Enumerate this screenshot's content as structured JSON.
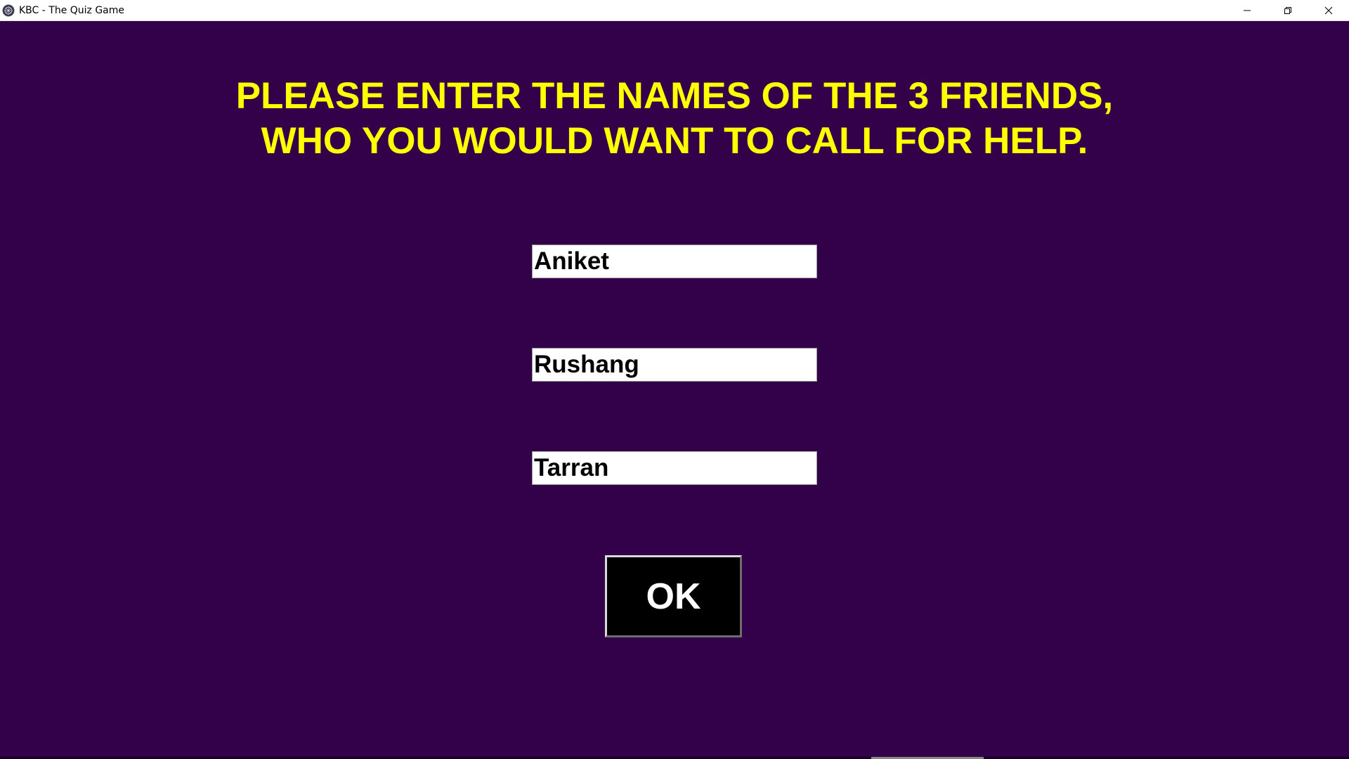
{
  "window": {
    "title": "KBC - The Quiz Game",
    "icon": "kbc-logo-icon",
    "controls": [
      "minimize-icon",
      "restore-icon",
      "close-icon"
    ]
  },
  "prompt": {
    "line1": "PLEASE ENTER THE NAMES OF THE 3 FRIENDS,",
    "line2": "WHO YOU WOULD WANT TO CALL FOR HELP."
  },
  "friends": [
    {
      "value": "Aniket"
    },
    {
      "value": "Rushang"
    },
    {
      "value": "Tarran"
    }
  ],
  "ok_button": {
    "label": "OK"
  },
  "colors": {
    "background": "#33004a",
    "prompt_text": "#ffff00",
    "button_bg": "#000000",
    "button_text": "#ffffff"
  }
}
